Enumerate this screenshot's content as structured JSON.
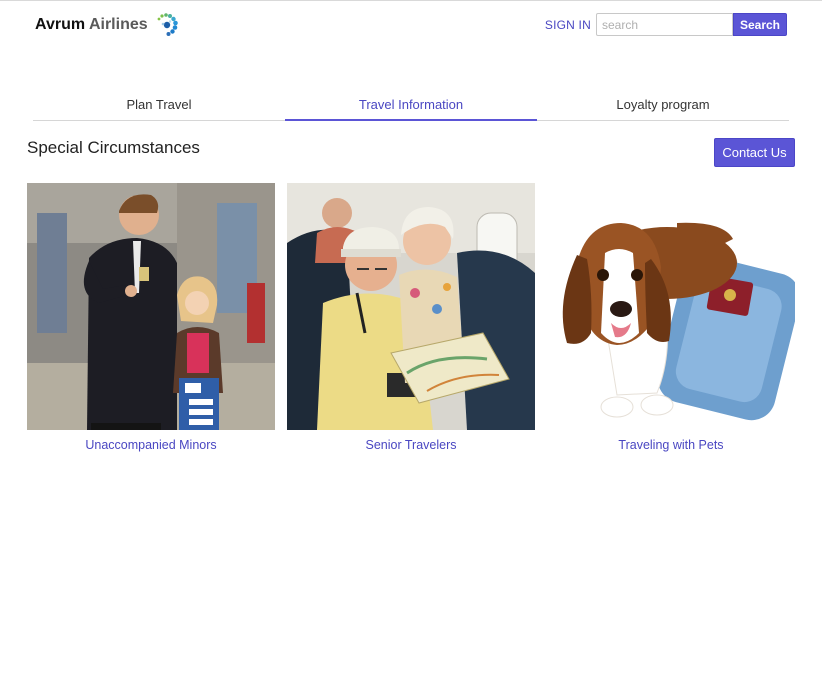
{
  "brand": {
    "name_part1": "Avrum",
    "name_part2": "Airlines"
  },
  "header": {
    "signin_label": "SIGN IN",
    "search_placeholder": "search",
    "search_value": "",
    "search_button_label": "Search"
  },
  "tabs": [
    {
      "label": "Plan Travel",
      "active": false
    },
    {
      "label": "Travel Information",
      "active": true
    },
    {
      "label": "Loyalty program",
      "active": false
    }
  ],
  "section": {
    "title": "Special Circumstances",
    "contact_button_label": "Contact Us"
  },
  "cards": [
    {
      "label": "Unaccompanied Minors",
      "image": "flight-attendant-with-child-photo"
    },
    {
      "label": "Senior Travelers",
      "image": "senior-couple-on-plane-photo"
    },
    {
      "label": "Traveling with Pets",
      "image": "basset-hound-with-suitcase-photo"
    }
  ],
  "colors": {
    "accent": "#5b55d6",
    "link": "#4a47c2"
  }
}
